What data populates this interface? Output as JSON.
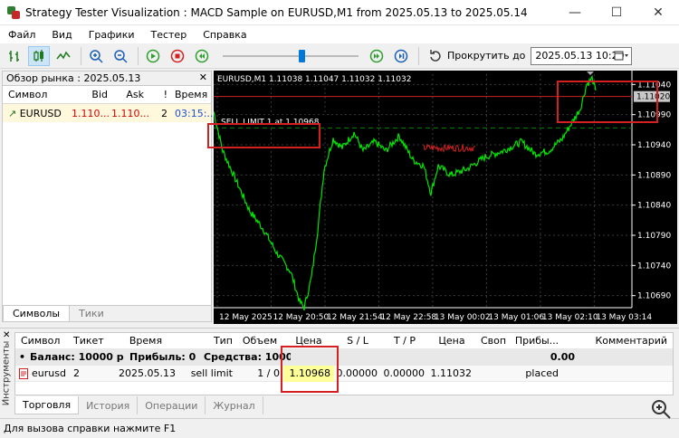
{
  "window": {
    "title": "Strategy Tester Visualization : MACD Sample on EURUSD,M1 from 2025.05.13 to 2025.05.14"
  },
  "menu": [
    "Файл",
    "Вид",
    "Графики",
    "Тестер",
    "Справка"
  ],
  "toolbar": {
    "scroll_label": "Прокрутить до",
    "date_value": "2025.05.13 10:20"
  },
  "market": {
    "title": "Обзор рынка : 2025.05.13",
    "headers": {
      "symbol": "Символ",
      "bid": "Bid",
      "ask": "Ask",
      "excl": "!",
      "time": "Время"
    },
    "row": {
      "symbol": "EURUSD",
      "bid": "1.110...",
      "ask": "1.110...",
      "excl": "2",
      "time": "03:15:..."
    },
    "tabs": [
      "Символы",
      "Тики"
    ]
  },
  "chart": {
    "header": "EURUSD,M1  1.11038 1.11047 1.11032 1.11032",
    "price_labels": [
      "1.11040",
      "1.10990",
      "1.10940",
      "1.10890",
      "1.10840",
      "1.10790",
      "1.10740",
      "1.10690"
    ],
    "current_price": "1.11020",
    "time_labels": [
      "12 May 2025",
      "12 May 20:50",
      "12 May 21:54",
      "12 May 22:58",
      "13 May 00:02",
      "13 May 01:06",
      "13 May 02:10",
      "13 May 03:14"
    ],
    "order_label": "SELL LIMIT 1 at 1.10968",
    "colors": {
      "bg": "#000000",
      "line": "#00e600",
      "grid": "#3a3a3a",
      "order": "#008800",
      "bid": "#cc2222"
    }
  },
  "terminal": {
    "side_label": "Инструменты",
    "headers": [
      "Символ",
      "Тикет",
      "Время",
      "Тип",
      "Объем",
      "Цена",
      "S / L",
      "T / P",
      "Цена",
      "Своп",
      "Прибы...",
      "Комментарий"
    ],
    "summary": {
      "balance": "Баланс: 10000 pips",
      "profit": "Прибыль: 0",
      "equity": "Средства: 10000",
      "total": "0.00"
    },
    "order": {
      "symbol": "eurusd",
      "ticket": "2",
      "time": "2025.05.13 ...",
      "type": "sell limit",
      "volume": "1 / 0",
      "price": "1.10968",
      "sl": "0.00000",
      "tp": "0.00000",
      "current": "1.11032",
      "swap": "",
      "profit": "placed",
      "comment": ""
    },
    "tabs": [
      "Торговля",
      "История",
      "Операции",
      "Журнал"
    ]
  },
  "status": {
    "text": "Для вызова справки нажмите F1"
  }
}
